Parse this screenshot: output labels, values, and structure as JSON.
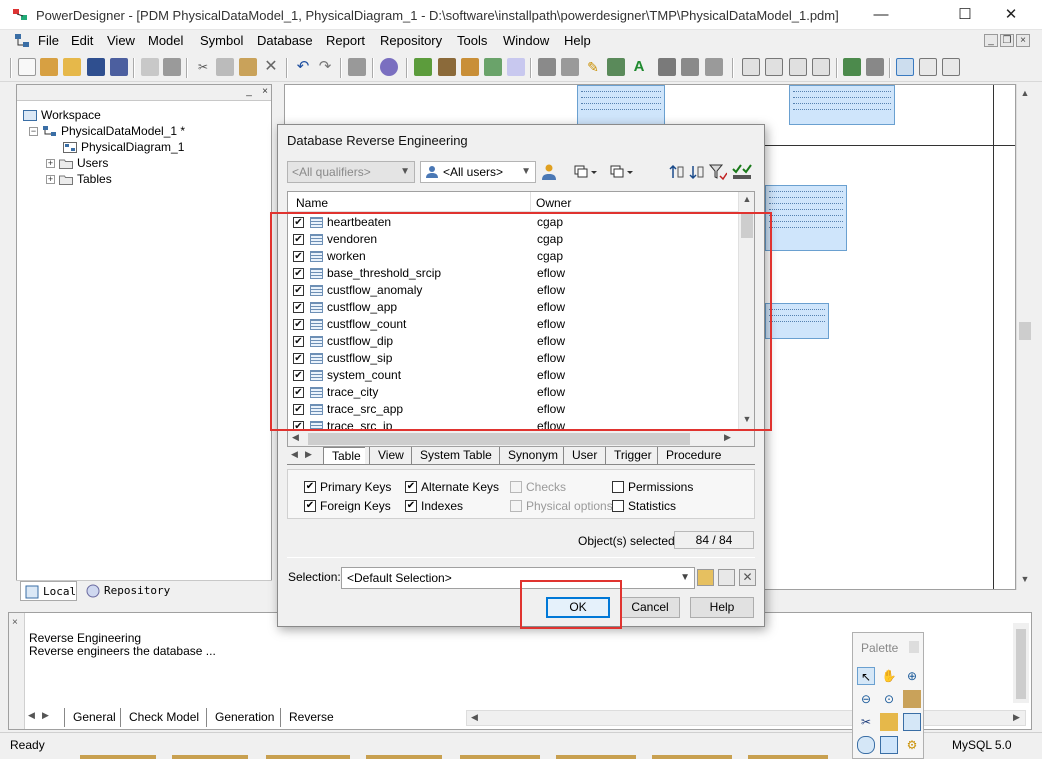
{
  "window": {
    "title": "PowerDesigner - [PDM PhysicalDataModel_1, PhysicalDiagram_1 - D:\\software\\installpath\\powerdesigner\\TMP\\PhysicalDataModel_1.pdm]",
    "minimize": "—",
    "maximize": "☐",
    "close": "✕"
  },
  "menu": [
    "File",
    "Edit",
    "View",
    "Model",
    "Symbol",
    "Database",
    "Report",
    "Repository",
    "Tools",
    "Window",
    "Help"
  ],
  "browser": {
    "items": {
      "workspace": "Workspace",
      "model": "PhysicalDataModel_1 *",
      "diagram": "PhysicalDiagram_1",
      "users": "Users",
      "tables": "Tables"
    },
    "tabs": {
      "local": "Local",
      "repository": "Repository"
    }
  },
  "dialog": {
    "title": "Database Reverse Engineering",
    "qualifiers": "<All qualifiers>",
    "users": "<All users>",
    "columns": {
      "name": "Name",
      "owner": "Owner"
    },
    "rows": [
      {
        "name": "heartbeaten",
        "owner": "cgap"
      },
      {
        "name": "vendoren",
        "owner": "cgap"
      },
      {
        "name": "worken",
        "owner": "cgap"
      },
      {
        "name": "base_threshold_srcip",
        "owner": "eflow"
      },
      {
        "name": "custflow_anomaly",
        "owner": "eflow"
      },
      {
        "name": "custflow_app",
        "owner": "eflow"
      },
      {
        "name": "custflow_count",
        "owner": "eflow"
      },
      {
        "name": "custflow_dip",
        "owner": "eflow"
      },
      {
        "name": "custflow_sip",
        "owner": "eflow"
      },
      {
        "name": "system_count",
        "owner": "eflow"
      },
      {
        "name": "trace_city",
        "owner": "eflow"
      },
      {
        "name": "trace_src_app",
        "owner": "eflow"
      },
      {
        "name": "trace_src_ip",
        "owner": "eflow"
      }
    ],
    "object_tabs": [
      "Table",
      "View",
      "System Table",
      "Synonym",
      "User",
      "Trigger",
      "Procedure"
    ],
    "options": {
      "primary_keys": {
        "label": "Primary Keys",
        "checked": true
      },
      "alternate_keys": {
        "label": "Alternate Keys",
        "checked": true
      },
      "checks": {
        "label": "Checks",
        "checked": false
      },
      "permissions": {
        "label": "Permissions",
        "checked": false
      },
      "foreign_keys": {
        "label": "Foreign Keys",
        "checked": true
      },
      "indexes": {
        "label": "Indexes",
        "checked": true
      },
      "physical_options": {
        "label": "Physical options",
        "checked": false
      },
      "statistics": {
        "label": "Statistics",
        "checked": false
      }
    },
    "selected_label": "Object(s) selected:",
    "selected_count": "84 / 84",
    "selection_label": "Selection:",
    "selection_value": "<Default Selection>",
    "buttons": {
      "ok": "OK",
      "cancel": "Cancel",
      "help": "Help"
    }
  },
  "output": {
    "lines": [
      "Reverse Engineering",
      "Reverse engineers the database ..."
    ],
    "tabs": [
      "General",
      "Check Model",
      "Generation",
      "Reverse"
    ]
  },
  "palette": {
    "title": "Palette"
  },
  "status": {
    "left": "Ready",
    "right": "MySQL 5.0"
  },
  "colors": {
    "highlight": "#e0332f",
    "entity_fill": "#cfe5fb",
    "accent": "#0078d7"
  }
}
